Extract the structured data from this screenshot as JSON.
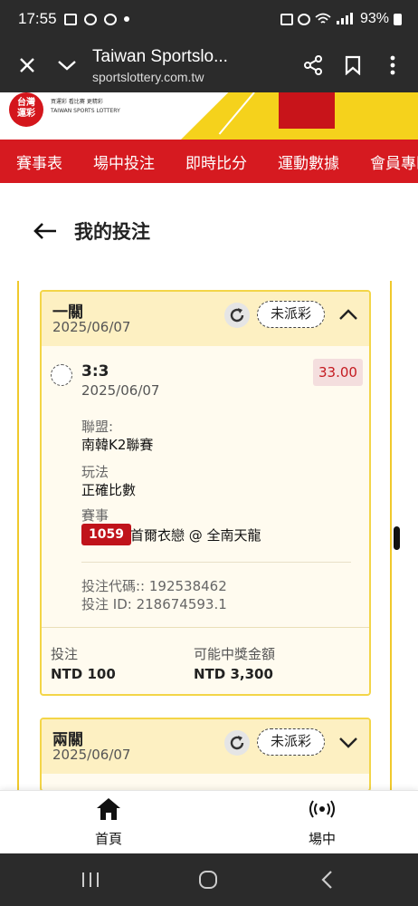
{
  "status_bar": {
    "time": "17:55",
    "battery": "93%"
  },
  "browser": {
    "title": "Taiwan Sportslo...",
    "url": "sportslottery.com.tw"
  },
  "site": {
    "logo_line1": "台灣",
    "logo_line2": "運彩",
    "logo_sub1": "買運彩 看比賽 更精彩",
    "logo_sub2": "TAIWAN SPORTS LOTTERY"
  },
  "nav": {
    "items": [
      "賽事表",
      "場中投注",
      "即時比分",
      "運動數據",
      "會員專區"
    ]
  },
  "page": {
    "title": "我的投注"
  },
  "bets": [
    {
      "name": "一關",
      "date": "2025/06/07",
      "status": "未派彩",
      "expanded": true,
      "selection": {
        "pick": "3:3",
        "date": "2025/06/07",
        "odds": "33.00",
        "league_label": "聯盟:",
        "league": "南韓K2聯賽",
        "play_label": "玩法",
        "play": "正確比數",
        "event_label": "賽事",
        "event_no": "1059",
        "event": "首爾衣戀 @ 全南天龍",
        "code": "投注代碼:: 192538462",
        "bet_id": "投注 ID: 218674593.1"
      },
      "stake_label": "投注",
      "stake": "NTD 100",
      "payout_label": "可能中獎金額",
      "payout": "NTD 3,300"
    },
    {
      "name": "兩關",
      "date": "2025/06/07",
      "status": "未派彩",
      "expanded": false
    }
  ],
  "bottom_tabs": [
    {
      "label": "首頁",
      "icon": "home-icon"
    },
    {
      "label": "場中",
      "icon": "live-broadcast-icon"
    }
  ],
  "colors": {
    "brand_red": "#d61a20",
    "accent_yellow": "#f3d548"
  }
}
